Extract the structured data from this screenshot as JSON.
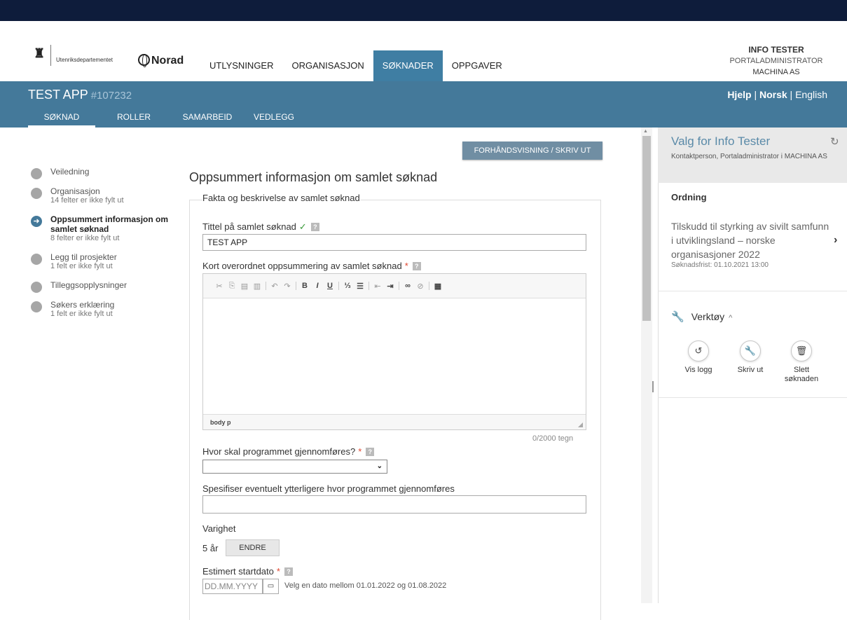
{
  "header": {
    "ministry": "Utenriksdepartementet",
    "norad": "Norad",
    "nav": [
      "UTLYSNINGER",
      "ORGANISASJON",
      "SØKNADER",
      "OPPGAVER"
    ],
    "active_nav": "SØKNADER",
    "user": {
      "name": "INFO TESTER",
      "role": "PORTALADMINISTRATOR",
      "org": "MACHINA AS"
    }
  },
  "app": {
    "title": "TEST APP",
    "id": "#107232",
    "help": "Hjelp",
    "sep1": "|",
    "lang_active": "Norsk",
    "sep2": "|",
    "lang_other": "English",
    "tabs": [
      "SØKNAD",
      "ROLLER",
      "SAMARBEID",
      "VEDLEGG"
    ],
    "active_tab": "SØKNAD"
  },
  "steps": [
    {
      "label": "Veiledning",
      "note": ""
    },
    {
      "label": "Organisasjon",
      "note": "14 felter er ikke fylt ut"
    },
    {
      "label": "Oppsummert informasjon om samlet søknad",
      "note": "8 felter er ikke fylt ut",
      "current": true
    },
    {
      "label": "Legg til prosjekter",
      "note": "1 felt er ikke fylt ut"
    },
    {
      "label": "Tilleggsopplysninger",
      "note": ""
    },
    {
      "label": "Søkers erklæring",
      "note": "1 felt er ikke fylt ut"
    }
  ],
  "form": {
    "preview_button": "FORHÅNDSVISNING / SKRIV UT",
    "section_title": "Oppsummert informasjon om samlet søknad",
    "legend": "Fakta og beskrivelse av samlet søknad",
    "title_label": "Tittel på samlet søknad",
    "title_value": "TEST APP",
    "summary_label": "Kort overordnet oppsummering av samlet søknad",
    "editor_path": "body  p",
    "counter": "0/2000 tegn",
    "where_label": "Hvor skal programmet gjennomføres?",
    "where_value": "",
    "specify_label": "Spesifiser eventuelt ytterligere hvor programmet gjennomføres",
    "specify_value": "",
    "duration_label": "Varighet",
    "duration_value": "5 år",
    "change_button": "ENDRE",
    "start_label": "Estimert startdato",
    "date_placeholder": "DD.MM.YYYY",
    "date_hint": "Velg en dato mellom 01.01.2022 og 01.08.2022",
    "required_mark": "*",
    "valid_mark": "✓",
    "help_mark": "?"
  },
  "right_panel": {
    "title": "Valg for Info Tester",
    "subtitle": "Kontaktperson, Portaladministrator i MACHINA AS",
    "ordning_label": "Ordning",
    "ordning_text": "Tilskudd til styrking av sivilt samfunn i utviklingsland – norske organisasjoner 2022",
    "deadline": "Søknadsfrist: 01.10.2021 13:00",
    "tools_label": "Verktøy",
    "tools": [
      {
        "label": "Vis logg",
        "icon": "history-icon"
      },
      {
        "label": "Skriv ut",
        "icon": "wrench-icon"
      },
      {
        "label": "Slett søknaden",
        "icon": "trash-icon"
      }
    ]
  },
  "colors": {
    "topbar": "#0e1c3b",
    "brand": "#44799a",
    "required": "#e0452e",
    "valid": "#3a9a3a"
  }
}
